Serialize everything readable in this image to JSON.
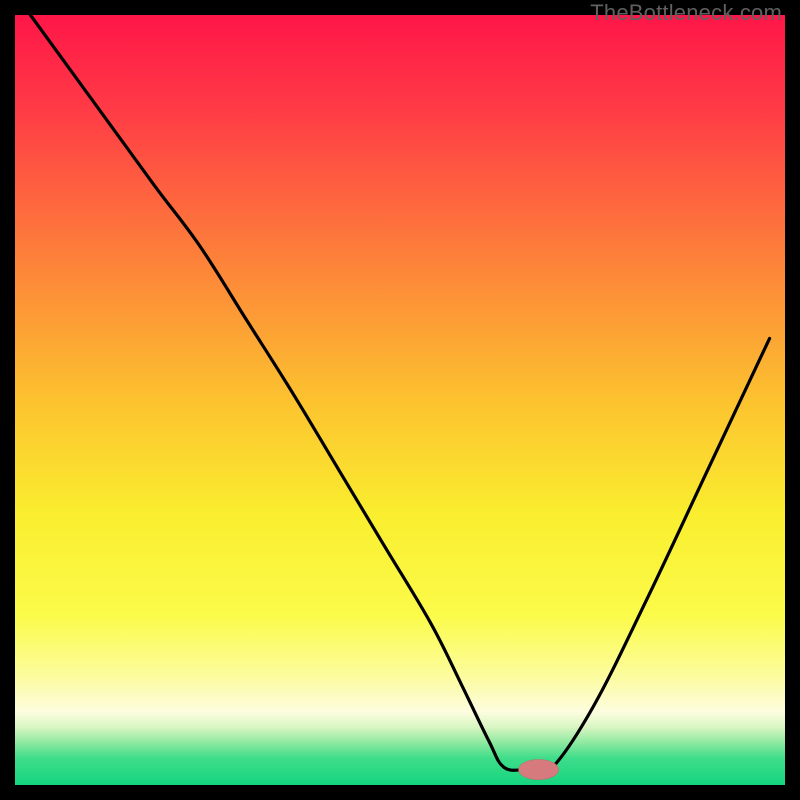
{
  "watermark": "TheBottleneck.com",
  "colors": {
    "frame": "#000000",
    "line": "#000000",
    "marker_fill": "#d77a7e",
    "marker_stroke": "#c86a6e",
    "gradient_stops": [
      {
        "offset": 0.0,
        "color": "#ff1648"
      },
      {
        "offset": 0.12,
        "color": "#ff3a46"
      },
      {
        "offset": 0.3,
        "color": "#fd7b3b"
      },
      {
        "offset": 0.5,
        "color": "#fcc22f"
      },
      {
        "offset": 0.65,
        "color": "#faee2f"
      },
      {
        "offset": 0.78,
        "color": "#fbfb4a"
      },
      {
        "offset": 0.86,
        "color": "#fcfca0"
      },
      {
        "offset": 0.905,
        "color": "#fdfde0"
      },
      {
        "offset": 0.925,
        "color": "#d8f6c2"
      },
      {
        "offset": 0.945,
        "color": "#8ee9a0"
      },
      {
        "offset": 0.965,
        "color": "#3fdd8a"
      },
      {
        "offset": 1.0,
        "color": "#14d57f"
      }
    ]
  },
  "chart_data": {
    "type": "line",
    "title": "",
    "xlabel": "",
    "ylabel": "",
    "xlim": [
      0,
      100
    ],
    "ylim": [
      0,
      100
    ],
    "series": [
      {
        "name": "bottleneck-curve",
        "x": [
          2,
          10,
          18,
          24,
          30,
          36,
          42,
          48,
          54,
          58,
          61.5,
          63.5,
          66.5,
          69.5,
          75,
          82,
          90,
          98
        ],
        "y": [
          100,
          89,
          78,
          70,
          60.5,
          51,
          41,
          31,
          21,
          13,
          5.8,
          2.3,
          2.0,
          2.0,
          10,
          24,
          41,
          58
        ]
      }
    ],
    "marker": {
      "x": 68,
      "y": 2.0,
      "rx": 2.6,
      "ry": 1.3
    },
    "note": "x and y are in percent of the inner plot area; y=0 is the bottom (green) edge, y=100 is the top (red) edge."
  }
}
